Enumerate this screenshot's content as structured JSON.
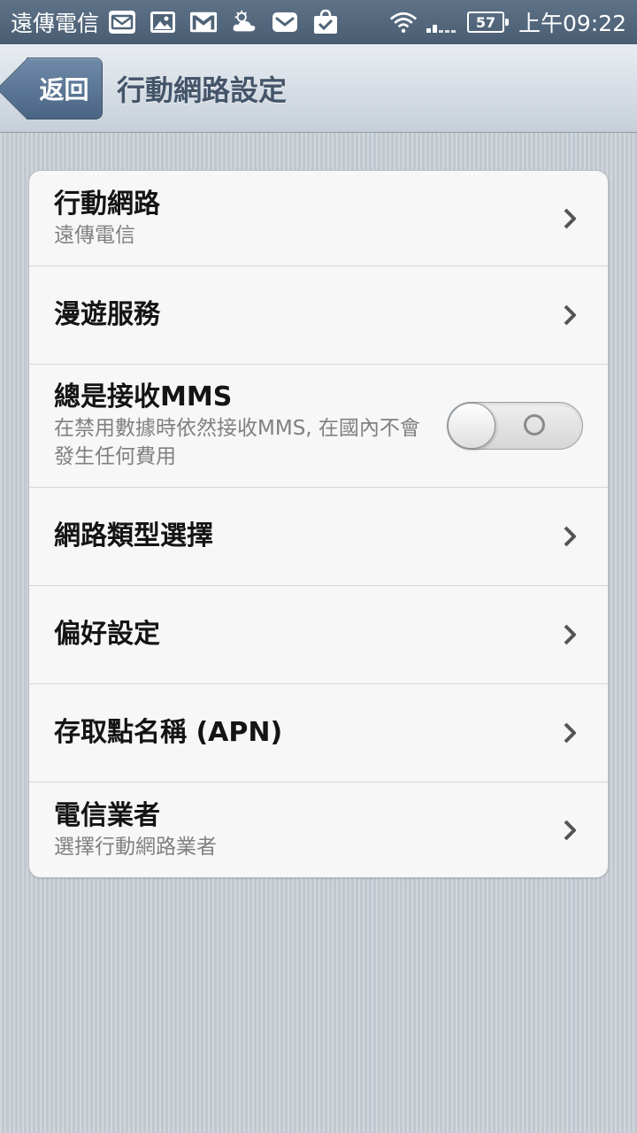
{
  "status_bar": {
    "carrier": "遠傳電信",
    "notification_icons": [
      "mail-icon",
      "image-icon",
      "gmail-icon",
      "weather-icon",
      "message-icon",
      "shopping-bag-icon"
    ],
    "battery_level": "57",
    "time": "上午09:22"
  },
  "header": {
    "back_label": "返回",
    "title": "行動網路設定"
  },
  "settings": {
    "items": [
      {
        "title": "行動網路",
        "subtitle": "遠傳電信"
      },
      {
        "title": "漫遊服務"
      },
      {
        "title": "總是接收MMS",
        "subtitle": "在禁用數據時依然接收MMS, 在國內不會發生任何費用",
        "toggle_on": false
      },
      {
        "title": "網路類型選擇"
      },
      {
        "title": "偏好設定"
      },
      {
        "title": "存取點名稱 (APN)"
      },
      {
        "title": "電信業者",
        "subtitle": "選擇行動網路業者"
      }
    ]
  },
  "colors": {
    "status_bar": "#4f6378",
    "back_button": "#5a7594",
    "title_text": "#44556a",
    "card_background": "#f7f7f7"
  }
}
